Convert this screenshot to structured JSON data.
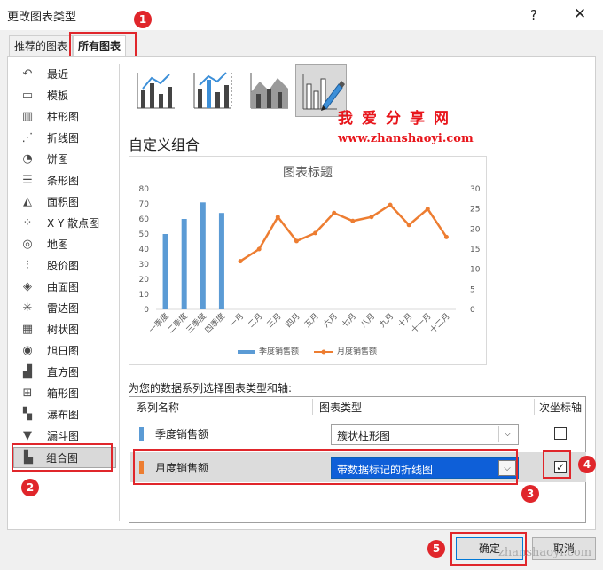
{
  "window": {
    "title": "更改图表类型",
    "help": "?",
    "close": "✕"
  },
  "tabs": [
    "推荐的图表",
    "所有图表"
  ],
  "badges": [
    "1",
    "2",
    "3",
    "4",
    "5"
  ],
  "sidebar": {
    "items": [
      {
        "label": "最近",
        "icon": "recent-icon",
        "glyph": "↶"
      },
      {
        "label": "模板",
        "icon": "folder-icon",
        "glyph": "▭"
      },
      {
        "label": "柱形图",
        "icon": "column-chart-icon",
        "glyph": "▥"
      },
      {
        "label": "折线图",
        "icon": "line-chart-icon",
        "glyph": "⋰"
      },
      {
        "label": "饼图",
        "icon": "pie-chart-icon",
        "glyph": "◔"
      },
      {
        "label": "条形图",
        "icon": "bar-chart-icon",
        "glyph": "☰"
      },
      {
        "label": "面积图",
        "icon": "area-chart-icon",
        "glyph": "◭"
      },
      {
        "label": "X Y 散点图",
        "icon": "scatter-chart-icon",
        "glyph": "⁘"
      },
      {
        "label": "地图",
        "icon": "map-chart-icon",
        "glyph": "◎"
      },
      {
        "label": "股价图",
        "icon": "stock-chart-icon",
        "glyph": "⫶"
      },
      {
        "label": "曲面图",
        "icon": "surface-chart-icon",
        "glyph": "◈"
      },
      {
        "label": "雷达图",
        "icon": "radar-chart-icon",
        "glyph": "✳"
      },
      {
        "label": "树状图",
        "icon": "treemap-chart-icon",
        "glyph": "▦"
      },
      {
        "label": "旭日图",
        "icon": "sunburst-chart-icon",
        "glyph": "◉"
      },
      {
        "label": "直方图",
        "icon": "histogram-chart-icon",
        "glyph": "▟"
      },
      {
        "label": "箱形图",
        "icon": "boxwhisker-chart-icon",
        "glyph": "⊞"
      },
      {
        "label": "瀑布图",
        "icon": "waterfall-chart-icon",
        "glyph": "▚"
      },
      {
        "label": "漏斗图",
        "icon": "funnel-chart-icon",
        "glyph": "▼"
      },
      {
        "label": "组合图",
        "icon": "combo-chart-icon",
        "glyph": "▙"
      }
    ],
    "selected": "组合图"
  },
  "watermark": {
    "text": "我爱分享网",
    "url": "www.zhanshaoyi.com",
    "corner": "zhanshaoyi.com"
  },
  "main": {
    "title": "自定义组合",
    "series_prompt": "为您的数据系列选择图表类型和轴:"
  },
  "table": {
    "headers": [
      "系列名称",
      "图表类型",
      "次坐标轴"
    ],
    "rows": [
      {
        "name": "季度销售额",
        "type": "簇状柱形图",
        "secondary": false,
        "color": "#5b9bd5"
      },
      {
        "name": "月度销售额",
        "type": "带数据标记的折线图",
        "secondary": true,
        "color": "#ed7d31"
      }
    ],
    "check_mark": "✓",
    "dropdown_arrow": "⌵"
  },
  "buttons": {
    "ok": "确定",
    "cancel": "取消"
  },
  "chart_data": {
    "type": "bar",
    "title": "图表标题",
    "categories": [
      "一季度",
      "二季度",
      "三季度",
      "四季度",
      "一月",
      "二月",
      "三月",
      "四月",
      "五月",
      "六月",
      "七月",
      "八月",
      "九月",
      "十月",
      "十一月",
      "十二月"
    ],
    "series": [
      {
        "name": "季度销售额",
        "type": "bar",
        "axis": "primary",
        "color": "#5b9bd5",
        "values": [
          50,
          60,
          71,
          64,
          null,
          null,
          null,
          null,
          null,
          null,
          null,
          null,
          null,
          null,
          null,
          null
        ]
      },
      {
        "name": "月度销售额",
        "type": "line",
        "axis": "secondary",
        "color": "#ed7d31",
        "values": [
          null,
          null,
          null,
          null,
          12,
          15,
          23,
          17,
          19,
          24,
          22,
          23,
          26,
          21,
          25,
          18
        ]
      }
    ],
    "ylim": [
      0,
      80
    ],
    "yticks": [
      "0",
      "10",
      "20",
      "30",
      "40",
      "50",
      "60",
      "70",
      "80"
    ],
    "y2lim": [
      0,
      30
    ],
    "y2ticks": [
      "0",
      "5",
      "10",
      "15",
      "20",
      "25",
      "30"
    ],
    "legend_position": "bottom",
    "grid": false
  }
}
